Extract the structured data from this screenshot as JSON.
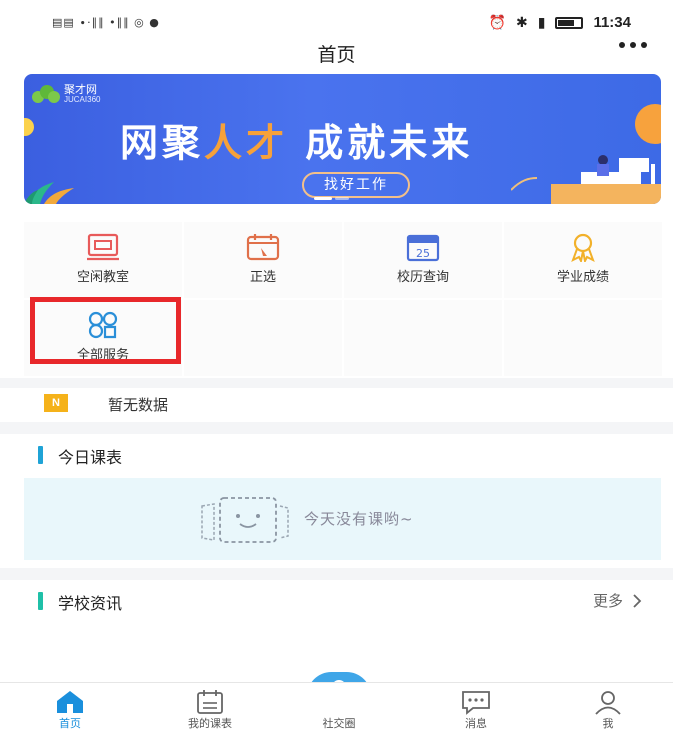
{
  "status_bar": {
    "left_indicators": "▤▤ ∙·∥∥ •∥∥ ◎ ●",
    "time": "11:34"
  },
  "header": {
    "title": "首页"
  },
  "banner": {
    "logo_name": "聚才网",
    "logo_sub": "JUCAI360",
    "slogan_part1": "网聚",
    "slogan_highlight": "人才",
    "slogan_part2": "成就未来",
    "button_label": "找好工作",
    "colors": {
      "bg": "#3b5fe0",
      "accent": "#f6a13a"
    }
  },
  "services": [
    {
      "label": "空闲教室",
      "icon": "classroom-icon"
    },
    {
      "label": "正选",
      "icon": "calendar-select-icon"
    },
    {
      "label": "校历查询",
      "icon": "calendar-25-icon"
    },
    {
      "label": "学业成绩",
      "icon": "award-ribbon-icon"
    },
    {
      "label": "全部服务",
      "icon": "all-services-icon"
    }
  ],
  "notice": {
    "badge": "N",
    "text": "暂无数据"
  },
  "schedule": {
    "title": "今日课表",
    "empty_text": "今天没有课哟~"
  },
  "news": {
    "title": "学校资讯",
    "more_label": "更多",
    "more_icon": "chevron-right-icon"
  },
  "tabs": [
    {
      "label": "首页",
      "icon": "home-icon",
      "active": true
    },
    {
      "label": "我的课表",
      "icon": "schedule-icon",
      "active": false
    },
    {
      "label": "社交圈",
      "icon": "community-icon",
      "active": false
    },
    {
      "label": "消息",
      "icon": "message-icon",
      "active": false
    },
    {
      "label": "我",
      "icon": "profile-icon",
      "active": false
    }
  ]
}
